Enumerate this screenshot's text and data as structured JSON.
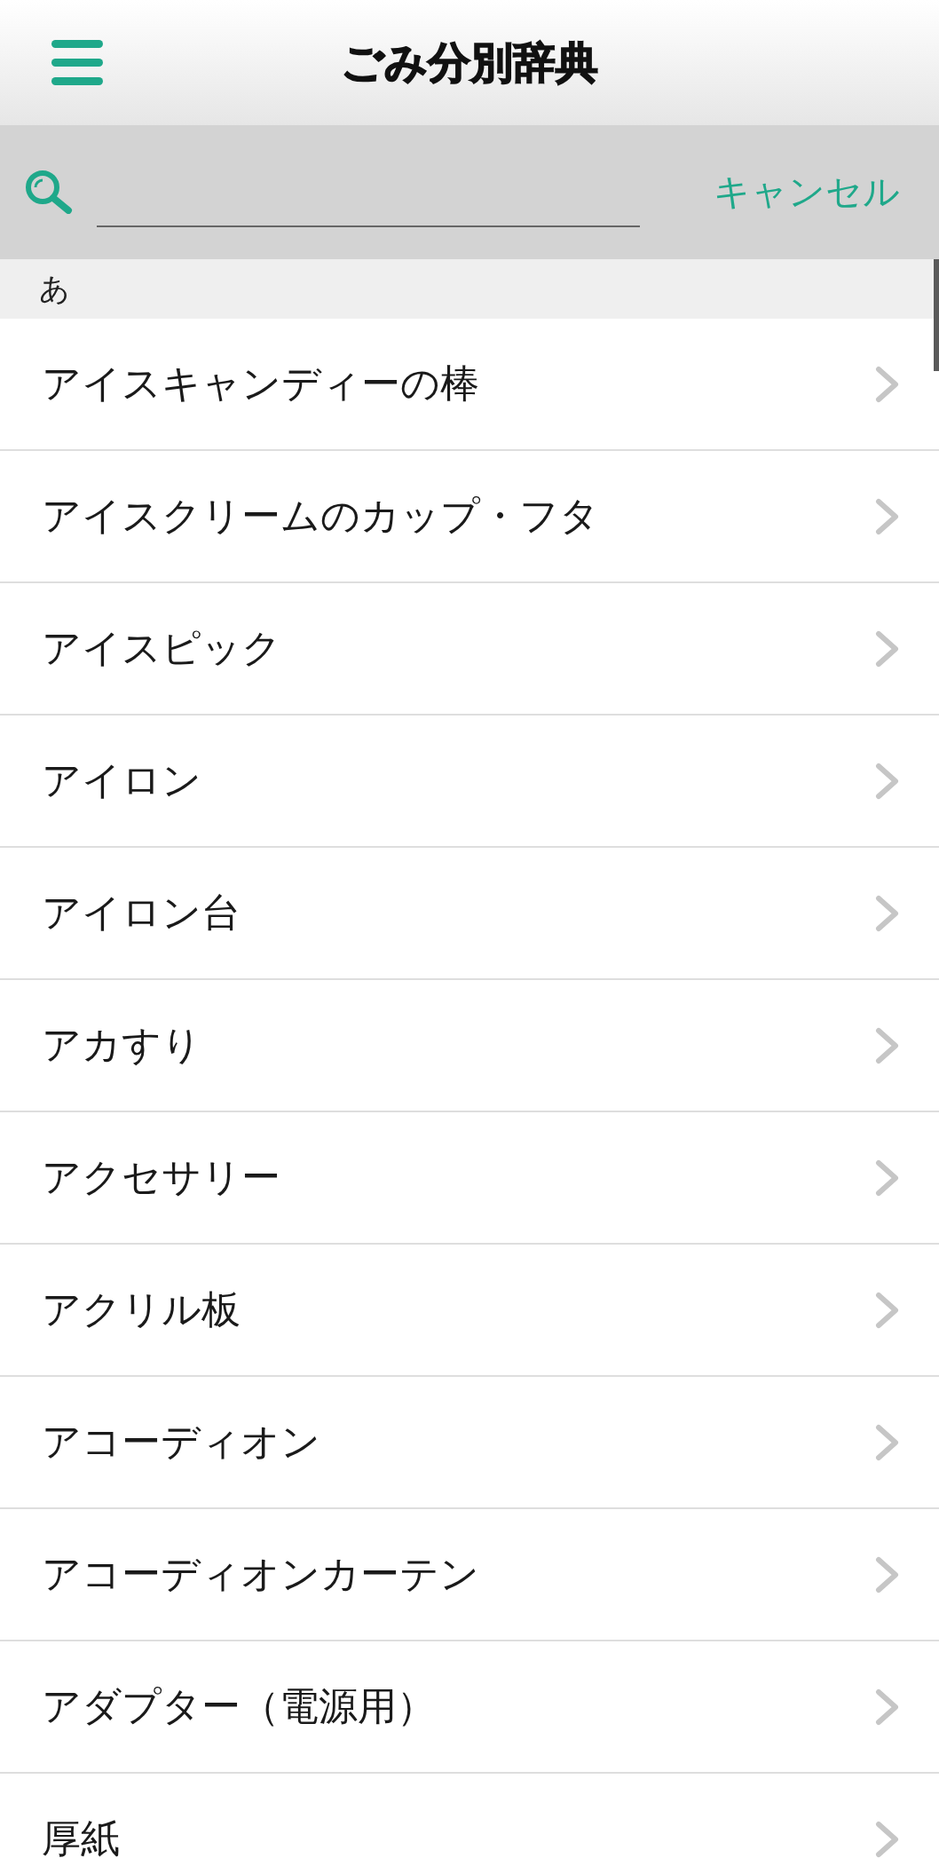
{
  "header": {
    "title": "ごみ分別辞典"
  },
  "search": {
    "cancel_label": "キャンセル"
  },
  "sections": [
    {
      "heading": "あ",
      "items": [
        "アイスキャンディーの棒",
        "アイスクリームのカップ・フタ",
        "アイスピック",
        "アイロン",
        "アイロン台",
        "アカすり",
        "アクセサリー",
        "アクリル板",
        "アコーディオン",
        "アコーディオンカーテン",
        "アダプター（電源用）",
        "厚紙"
      ]
    }
  ]
}
